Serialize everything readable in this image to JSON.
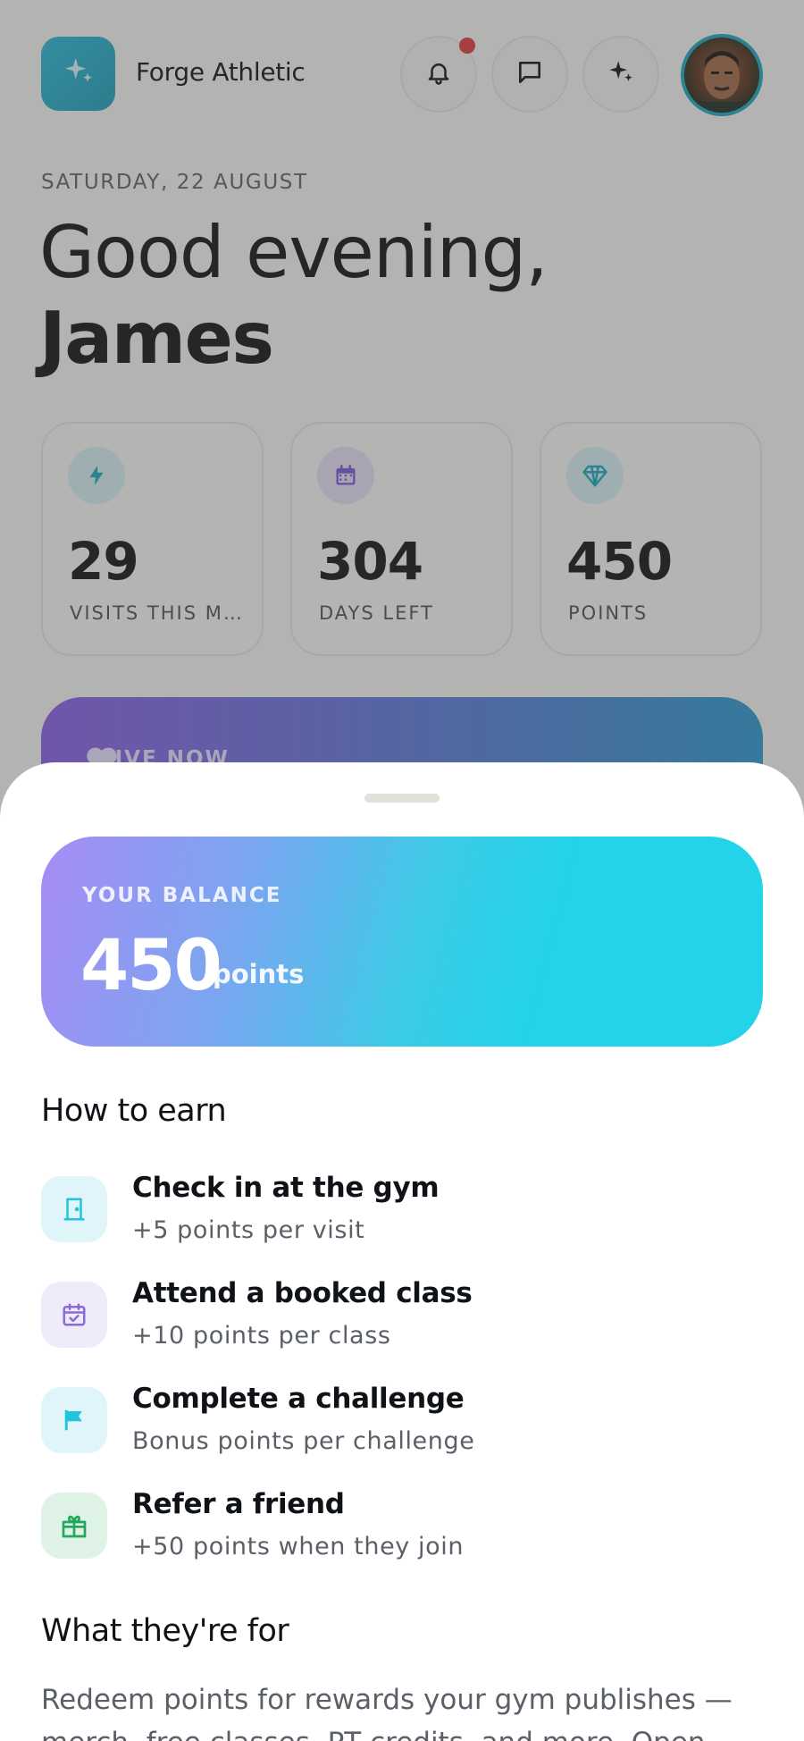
{
  "header": {
    "brand_name": "Forge Athletic",
    "notification_badge": true
  },
  "greeting": {
    "date": "SATURDAY, 22 AUGUST",
    "line1": "Good evening,",
    "name": "James"
  },
  "stats": [
    {
      "value": "29",
      "label": "VISITS THIS MONTH",
      "icon": "bolt-icon",
      "color": "#1ea6c0"
    },
    {
      "value": "304",
      "label": "DAYS LEFT",
      "icon": "calendar-icon",
      "color": "#7a58d8"
    },
    {
      "value": "450",
      "label": "POINTS",
      "icon": "diamond-icon",
      "color": "#1ea6c0"
    }
  ],
  "live_banner": {
    "label": "LIVE NOW"
  },
  "sheet": {
    "balance": {
      "label": "YOUR BALANCE",
      "value": "450",
      "unit": "points"
    },
    "how_to_earn": {
      "title": "How to earn",
      "items": [
        {
          "title": "Check in at the gym",
          "subtitle": "+5 points per visit",
          "icon": "door-icon",
          "bg": "#dff5f9",
          "color": "#22c3dc"
        },
        {
          "title": "Attend a booked class",
          "subtitle": "+10 points per class",
          "icon": "calendar-check-icon",
          "bg": "#f0ebfb",
          "color": "#8a6ad8"
        },
        {
          "title": "Complete a challenge",
          "subtitle": "Bonus points per challenge",
          "icon": "flag-icon",
          "bg": "#dff5f9",
          "color": "#22c3dc"
        },
        {
          "title": "Refer a friend",
          "subtitle": "+50 points when they join",
          "icon": "gift-icon",
          "bg": "#def3e6",
          "color": "#22a85c"
        }
      ]
    },
    "what_for": {
      "title": "What they're for",
      "body": "Redeem points for rewards your gym publishes — merch, free classes, PT credits, and more. Open"
    }
  }
}
